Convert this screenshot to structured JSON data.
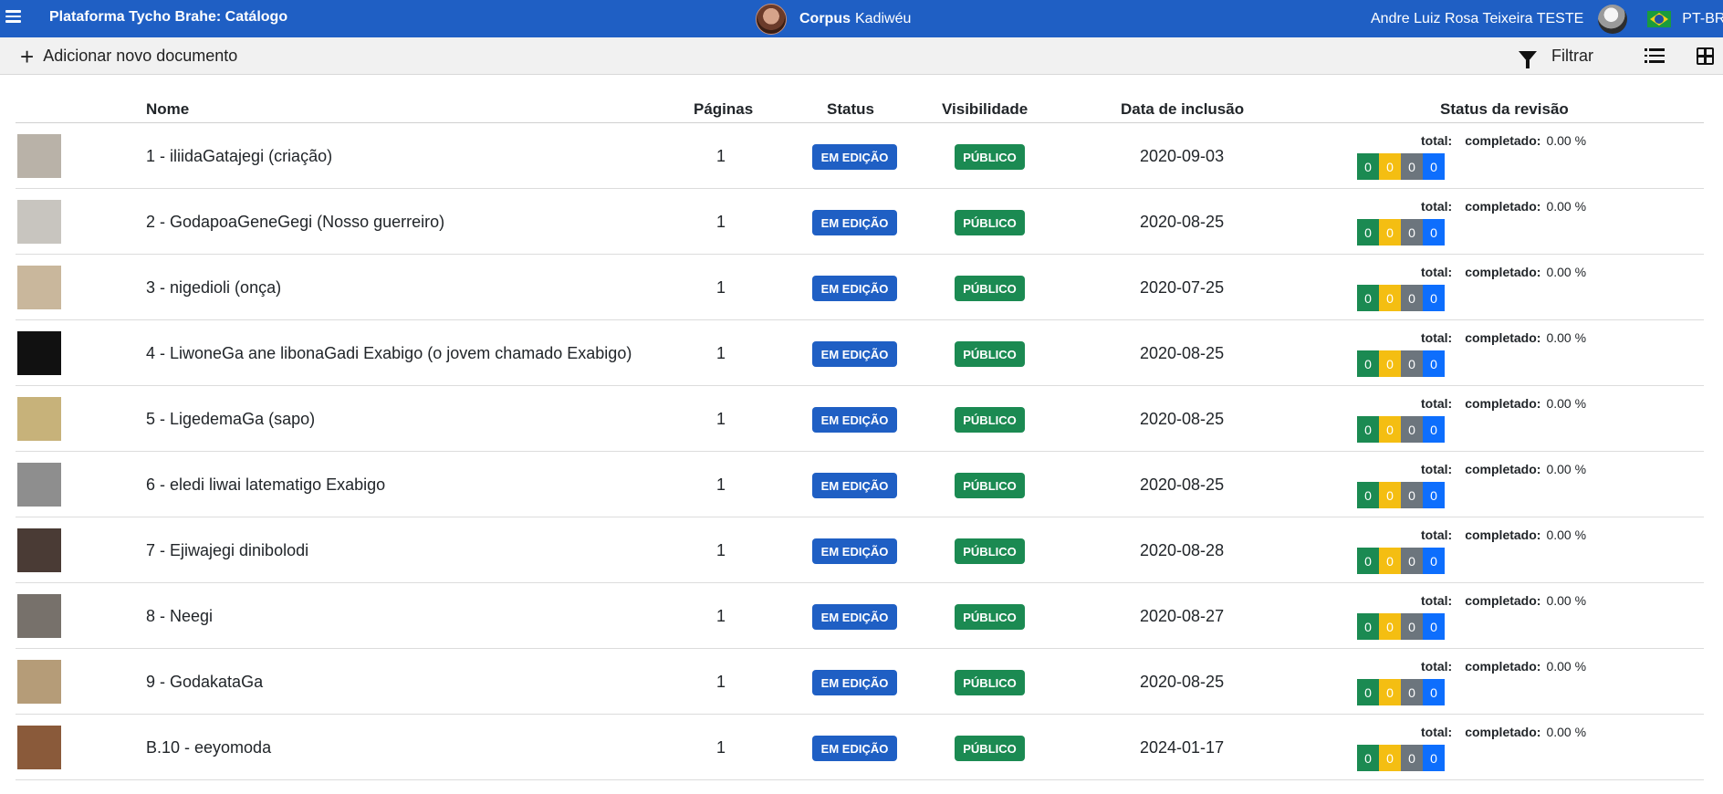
{
  "navbar": {
    "brand": "Plataforma Tycho Brahe: Catálogo",
    "corpus_label": "Corpus",
    "corpus_name": "Kadiwéu",
    "user_name": "Andre Luiz Rosa Teixeira TESTE",
    "language": "PT-BR",
    "accent_color": "#1f5fc4"
  },
  "toolbar": {
    "add_label": "Adicionar novo documento",
    "filter_label": "Filtrar"
  },
  "table": {
    "headers": {
      "name": "Nome",
      "pages": "Páginas",
      "status": "Status",
      "visibility": "Visibilidade",
      "date": "Data de inclusão",
      "review": "Status da revisão"
    },
    "review_labels": {
      "total": "total:",
      "completed": "completado:"
    },
    "rows": [
      {
        "name": "1 - iliidaGatajegi (criação)",
        "pages": "1",
        "status": "EM EDIÇÃO",
        "visibility": "PÚBLICO",
        "date": "2020-09-03",
        "percent": "0.00 %",
        "counts": [
          "0",
          "0",
          "0",
          "0"
        ],
        "thumb": "#b9b2a8"
      },
      {
        "name": "2 - GodapoaGeneGegi (Nosso guerreiro)",
        "pages": "1",
        "status": "EM EDIÇÃO",
        "visibility": "PÚBLICO",
        "date": "2020-08-25",
        "percent": "0.00 %",
        "counts": [
          "0",
          "0",
          "0",
          "0"
        ],
        "thumb": "#c8c5bf"
      },
      {
        "name": "3 - nigedioli (onça)",
        "pages": "1",
        "status": "EM EDIÇÃO",
        "visibility": "PÚBLICO",
        "date": "2020-07-25",
        "percent": "0.00 %",
        "counts": [
          "0",
          "0",
          "0",
          "0"
        ],
        "thumb": "#c9b79c"
      },
      {
        "name": "4 - LiwoneGa ane libonaGadi Exabigo (o jovem chamado Exabigo)",
        "pages": "1",
        "status": "EM EDIÇÃO",
        "visibility": "PÚBLICO",
        "date": "2020-08-25",
        "percent": "0.00 %",
        "counts": [
          "0",
          "0",
          "0",
          "0"
        ],
        "thumb": "#111111"
      },
      {
        "name": "5 - LigedemaGa (sapo)",
        "pages": "1",
        "status": "EM EDIÇÃO",
        "visibility": "PÚBLICO",
        "date": "2020-08-25",
        "percent": "0.00 %",
        "counts": [
          "0",
          "0",
          "0",
          "0"
        ],
        "thumb": "#c7b27a"
      },
      {
        "name": "6 - eledi liwai latematigo Exabigo",
        "pages": "1",
        "status": "EM EDIÇÃO",
        "visibility": "PÚBLICO",
        "date": "2020-08-25",
        "percent": "0.00 %",
        "counts": [
          "0",
          "0",
          "0",
          "0"
        ],
        "thumb": "#8e8e8e"
      },
      {
        "name": "7 - Ejiwajegi dinibolodi",
        "pages": "1",
        "status": "EM EDIÇÃO",
        "visibility": "PÚBLICO",
        "date": "2020-08-28",
        "percent": "0.00 %",
        "counts": [
          "0",
          "0",
          "0",
          "0"
        ],
        "thumb": "#4a3b35"
      },
      {
        "name": "8 - Neegi",
        "pages": "1",
        "status": "EM EDIÇÃO",
        "visibility": "PÚBLICO",
        "date": "2020-08-27",
        "percent": "0.00 %",
        "counts": [
          "0",
          "0",
          "0",
          "0"
        ],
        "thumb": "#77716b"
      },
      {
        "name": "9 - GodakataGa",
        "pages": "1",
        "status": "EM EDIÇÃO",
        "visibility": "PÚBLICO",
        "date": "2020-08-25",
        "percent": "0.00 %",
        "counts": [
          "0",
          "0",
          "0",
          "0"
        ],
        "thumb": "#b59c78"
      },
      {
        "name": "B.10 - eeyomoda",
        "pages": "1",
        "status": "EM EDIÇÃO",
        "visibility": "PÚBLICO",
        "date": "2024-01-17",
        "percent": "0.00 %",
        "counts": [
          "0",
          "0",
          "0",
          "0"
        ],
        "thumb": "#8a5a3a"
      }
    ]
  }
}
